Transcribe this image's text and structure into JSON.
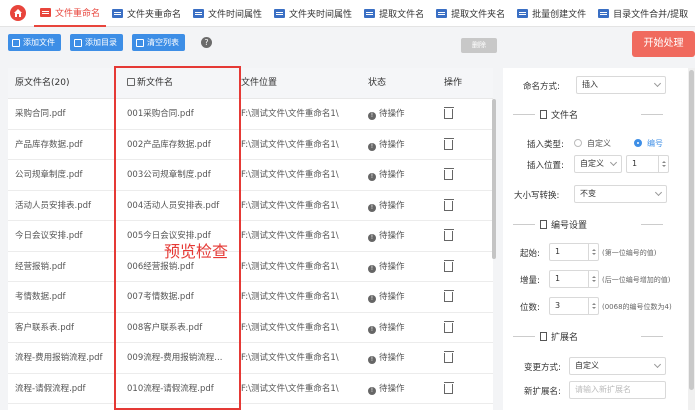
{
  "nav": {
    "tabs": [
      {
        "label": "文件重命名",
        "active": true
      },
      {
        "label": "文件夹重命名"
      },
      {
        "label": "文件时间属性"
      },
      {
        "label": "文件夹时间属性"
      },
      {
        "label": "提取文件名"
      },
      {
        "label": "提取文件夹名"
      },
      {
        "label": "批量创建文件"
      },
      {
        "label": "目录文件合并/提取"
      }
    ]
  },
  "toolbar": {
    "add_file": "添加文件",
    "add_dir": "添加目录",
    "clear_list": "清空列表",
    "help": "?",
    "delete": "删除",
    "start": "开始处理"
  },
  "table": {
    "headers": {
      "original": "原文件名(20)",
      "new": "新文件名",
      "location": "文件位置",
      "status": "状态",
      "ops": "操作"
    },
    "rows": [
      {
        "original": "采购合同.pdf",
        "new": "001采购合同.pdf",
        "location": "F:\\测试文件\\文件重命名1\\",
        "status": "待操作"
      },
      {
        "original": "产品库存数据.pdf",
        "new": "002产品库存数据.pdf",
        "location": "F:\\测试文件\\文件重命名1\\",
        "status": "待操作"
      },
      {
        "original": "公司规章制度.pdf",
        "new": "003公司规章制度.pdf",
        "location": "F:\\测试文件\\文件重命名1\\",
        "status": "待操作"
      },
      {
        "original": "活动人员安排表.pdf",
        "new": "004活动人员安排表.pdf",
        "location": "F:\\测试文件\\文件重命名1\\",
        "status": "待操作"
      },
      {
        "original": "今日会议安排.pdf",
        "new": "005今日会议安排.pdf",
        "location": "F:\\测试文件\\文件重命名1\\",
        "status": "待操作"
      },
      {
        "original": "经营报销.pdf",
        "new": "006经营报销.pdf",
        "location": "F:\\测试文件\\文件重命名1\\",
        "status": "待操作"
      },
      {
        "original": "考情数据.pdf",
        "new": "007考情数据.pdf",
        "location": "F:\\测试文件\\文件重命名1\\",
        "status": "待操作"
      },
      {
        "original": "客户联系表.pdf",
        "new": "008客户联系表.pdf",
        "location": "F:\\测试文件\\文件重命名1\\",
        "status": "待操作"
      },
      {
        "original": "流程-费用报销流程.pdf",
        "new": "009流程-费用报销流程...",
        "location": "F:\\测试文件\\文件重命名1\\",
        "status": "待操作"
      },
      {
        "original": "流程-请假流程.pdf",
        "new": "010流程-请假流程.pdf",
        "location": "F:\\测试文件\\文件重命名1\\",
        "status": "待操作"
      }
    ]
  },
  "preview_label": "预览检查",
  "settings": {
    "mode_label": "命名方式:",
    "mode_value": "插入",
    "section_filename": "文件名",
    "insert_type_label": "插入类型:",
    "insert_type_custom": "自定义",
    "insert_type_number": "编号",
    "insert_pos_label": "插入位置:",
    "insert_pos_value": "自定义",
    "insert_pos_num": "1",
    "case_label": "大小写转换:",
    "case_value": "不变",
    "section_number": "编号设置",
    "start_label": "起始:",
    "start_value": "1",
    "start_hint": "(第一位编号的值)",
    "step_label": "增量:",
    "step_value": "1",
    "step_hint": "(后一位编号增加的值)",
    "digits_label": "位数:",
    "digits_value": "3",
    "digits_hint": "(0068的编号位数为4)",
    "section_ext": "扩展名",
    "ext_mode_label": "变更方式:",
    "ext_mode_value": "自定义",
    "new_ext_label": "新扩展名:",
    "new_ext_placeholder": "请输入新扩展名"
  }
}
